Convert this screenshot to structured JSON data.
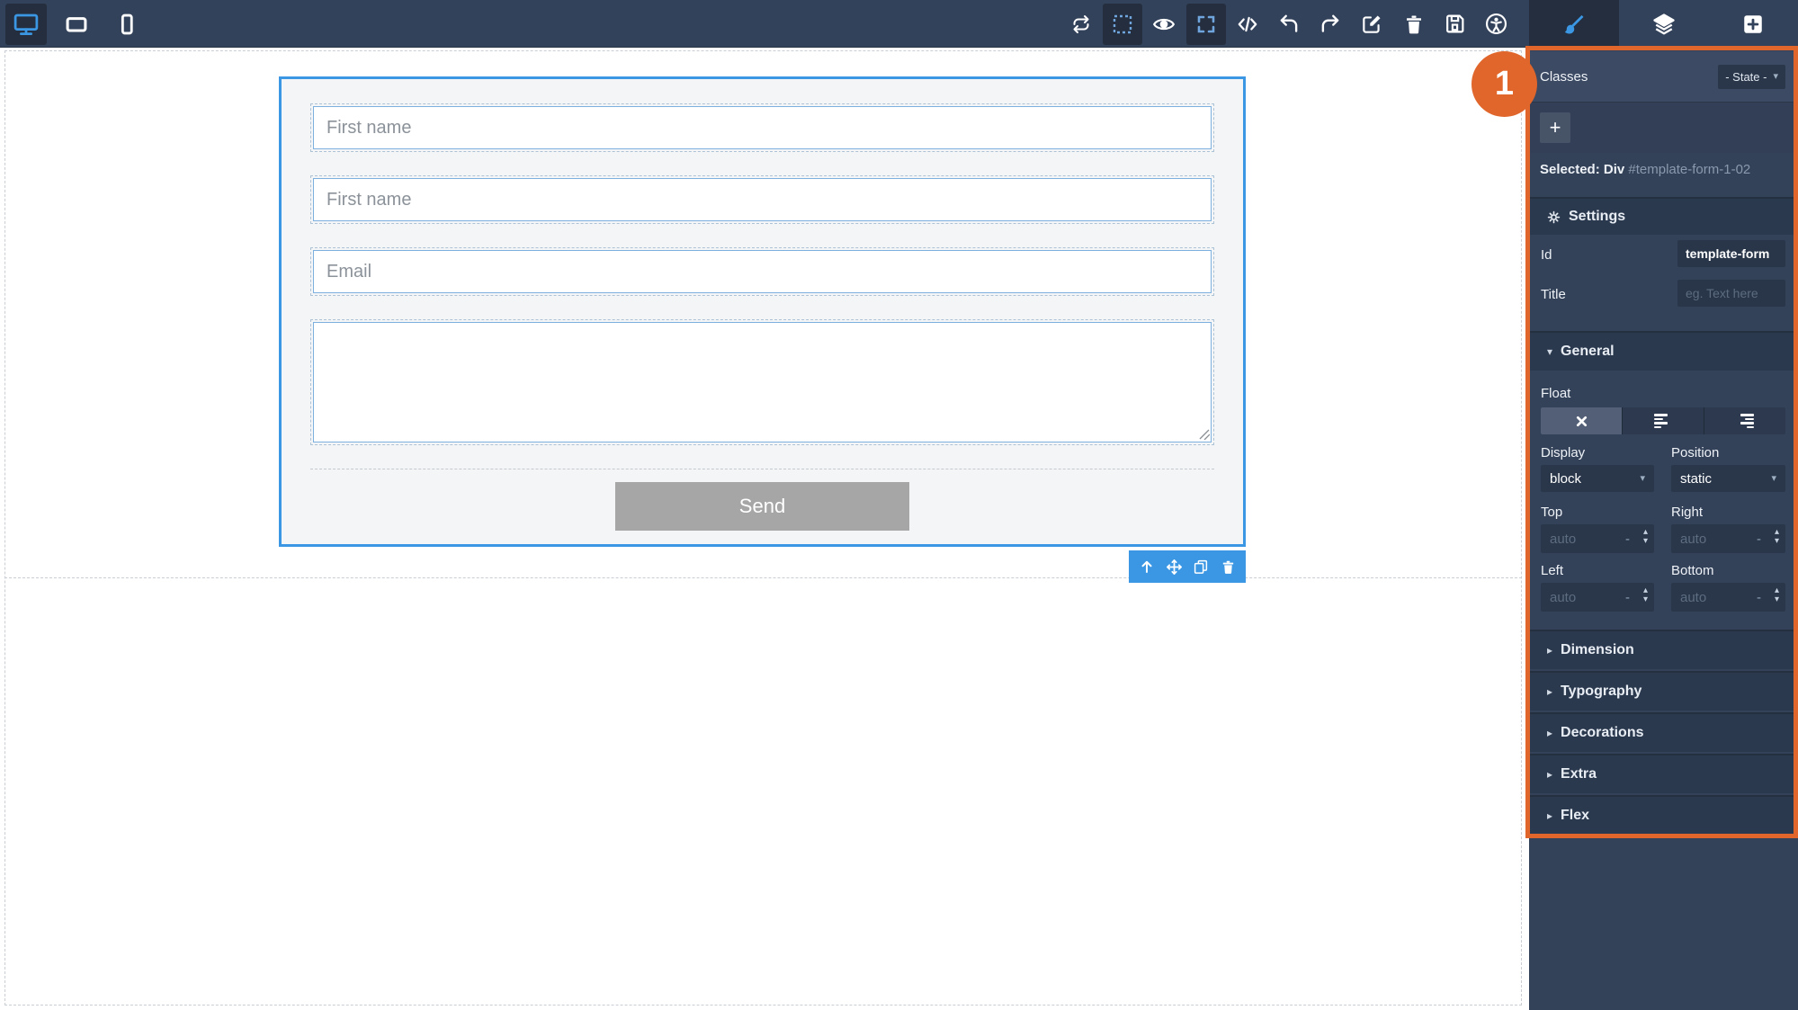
{
  "topbar": {
    "device_switcher": {
      "items": [
        "desktop",
        "tablet",
        "mobile"
      ],
      "active": "desktop"
    },
    "action_icons": [
      "swap-arrows",
      "toggle-borders",
      "preview-eye",
      "fullscreen",
      "code",
      "undo",
      "redo",
      "edit",
      "trash",
      "save",
      "accessibility"
    ],
    "active_action_icons": [
      "toggle-borders",
      "fullscreen"
    ],
    "panel_switcher": {
      "items": [
        "style-manager-brush",
        "layers",
        "blocks-plus"
      ],
      "active": "style-manager-brush"
    }
  },
  "canvas": {
    "form": {
      "fields": [
        {
          "placeholder": "First name"
        },
        {
          "placeholder": "First name"
        },
        {
          "placeholder": "Email"
        }
      ],
      "message_textarea": {
        "value": ""
      },
      "send_button": "Send"
    },
    "component_toolbar": {
      "icons": [
        "select-parent-arrow",
        "move",
        "copy",
        "delete"
      ]
    }
  },
  "annotation": {
    "step_badge": "1"
  },
  "sidebar": {
    "classes": {
      "label": "Classes",
      "state_selector": "- State -",
      "add_class_button": "+"
    },
    "selected": {
      "label": "Selected:",
      "element": "Div",
      "element_id": "#template-form-1-02"
    },
    "settings": {
      "title": "Settings",
      "id_label": "Id",
      "id_value": "template-form",
      "title_label": "Title",
      "title_placeholder": "eg. Text here"
    },
    "general": {
      "title": "General",
      "float": {
        "label": "Float",
        "options": [
          "none",
          "left",
          "right"
        ],
        "selected": "none"
      },
      "display": {
        "label": "Display",
        "value": "block"
      },
      "position": {
        "label": "Position",
        "value": "static"
      },
      "offsets": [
        {
          "label": "Top",
          "placeholder": "auto",
          "unit": "-"
        },
        {
          "label": "Right",
          "placeholder": "auto",
          "unit": "-"
        },
        {
          "label": "Left",
          "placeholder": "auto",
          "unit": "-"
        },
        {
          "label": "Bottom",
          "placeholder": "auto",
          "unit": "-"
        }
      ]
    },
    "collapsed_sections": [
      {
        "label": "Dimension"
      },
      {
        "label": "Typography"
      },
      {
        "label": "Decorations"
      },
      {
        "label": "Extra"
      },
      {
        "label": "Flex"
      }
    ]
  },
  "glyphs": {
    "caret_down": "▾",
    "caret_right": "▸",
    "spinner_up": "▴",
    "spinner_down": "▾"
  },
  "colors": {
    "accent_blue": "#3b97e3",
    "annotation_orange": "#e0662b",
    "panel_bg": "#344259",
    "send_button_gray": "#a6a6a6"
  }
}
